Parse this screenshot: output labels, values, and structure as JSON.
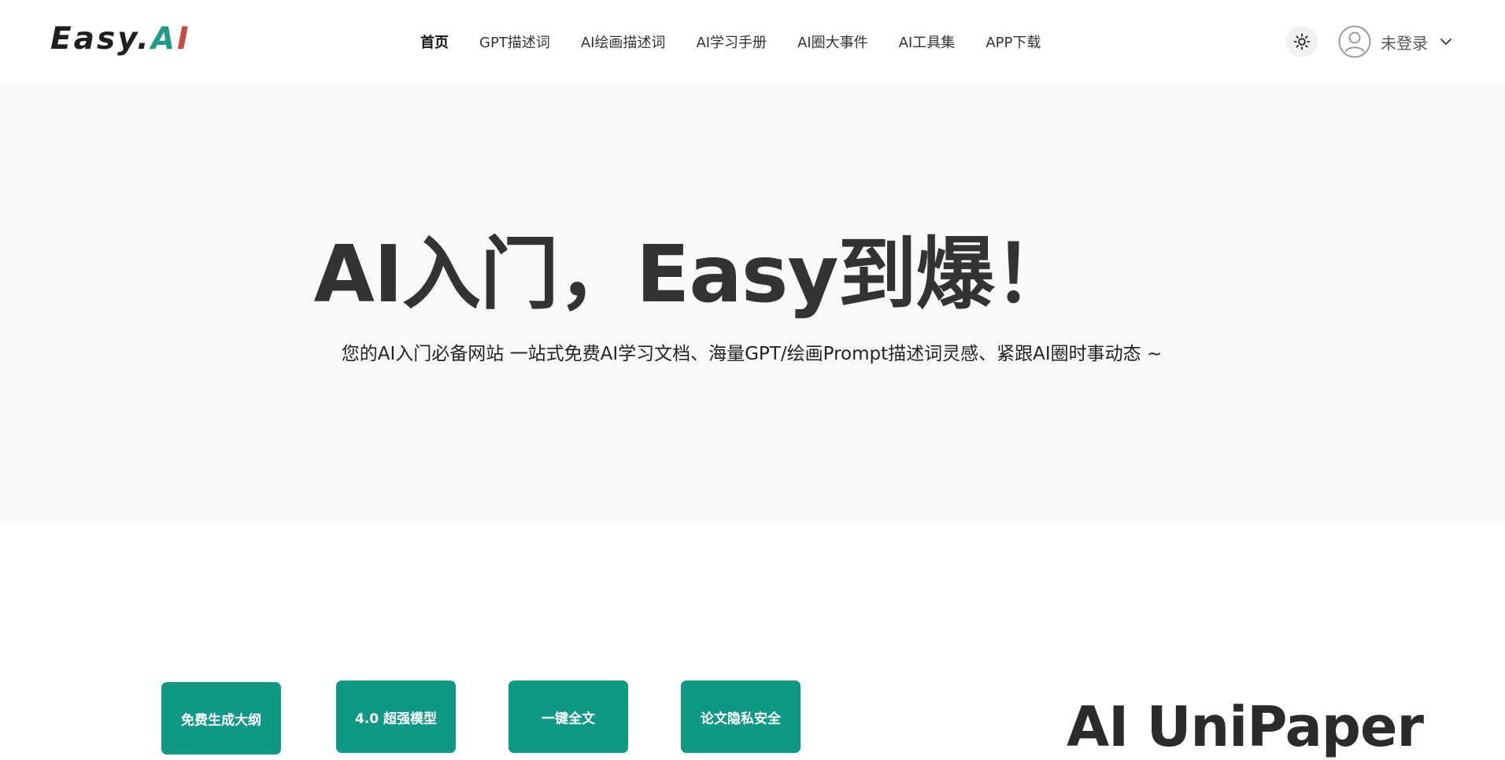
{
  "brand": {
    "logo_main": "Easy.",
    "logo_accent_a": "A",
    "logo_accent_i": "I",
    "colors": {
      "dark": "#1f1f1f",
      "teal": "#1e9b89",
      "red": "#c64a3d"
    }
  },
  "nav": {
    "items": [
      {
        "label": "首页",
        "active": true
      },
      {
        "label": "GPT描述词",
        "active": false
      },
      {
        "label": "AI绘画描述词",
        "active": false
      },
      {
        "label": "AI学习手册",
        "active": false
      },
      {
        "label": "AI圈大事件",
        "active": false
      },
      {
        "label": "AI工具集",
        "active": false
      },
      {
        "label": "APP下载",
        "active": false
      }
    ]
  },
  "header_actions": {
    "theme_icon": "sun-icon",
    "user_icon": "user-avatar-icon",
    "user_label": "未登录",
    "dropdown_icon": "chevron-down-icon"
  },
  "hero": {
    "title": "AI入门，Easy到爆！",
    "subtitle": "您的AI入门必备网站 一站式免费AI学习文档、海量GPT/绘画Prompt描述词灵感、紧跟AI圈时事动态 ~",
    "background": "#f9f9f9"
  },
  "features": {
    "buttons": [
      {
        "label": "免费生成大纲"
      },
      {
        "label": "4.0 超强模型"
      },
      {
        "label": "一键全文"
      },
      {
        "label": "论文隐私安全"
      }
    ],
    "accent_color": "#0f9985",
    "product_title": "AI UniPaper"
  }
}
